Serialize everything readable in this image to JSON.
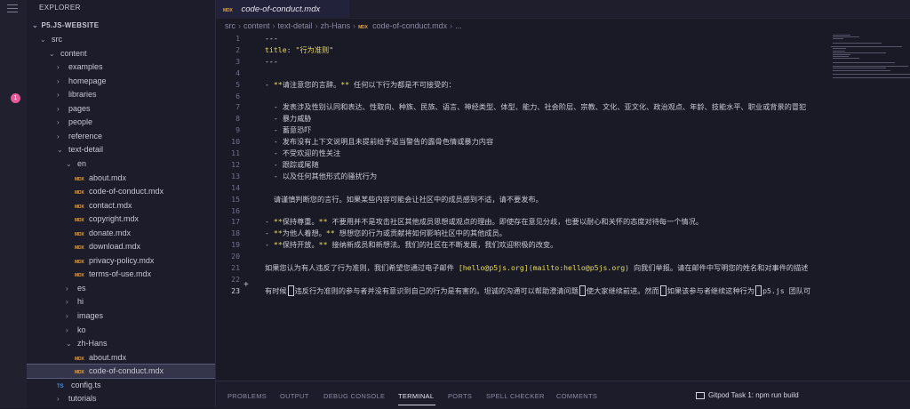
{
  "activity": {
    "badge": "1"
  },
  "sidebar": {
    "title": "EXPLORER",
    "root": "P5.JS-WEBSITE",
    "tree": [
      {
        "label": "src",
        "type": "folder",
        "open": true,
        "depth": 0
      },
      {
        "label": "content",
        "type": "folder",
        "open": true,
        "depth": 1
      },
      {
        "label": "examples",
        "type": "folder",
        "open": false,
        "depth": 2
      },
      {
        "label": "homepage",
        "type": "folder",
        "open": false,
        "depth": 2
      },
      {
        "label": "libraries",
        "type": "folder",
        "open": false,
        "depth": 2
      },
      {
        "label": "pages",
        "type": "folder",
        "open": false,
        "depth": 2
      },
      {
        "label": "people",
        "type": "folder",
        "open": false,
        "depth": 2
      },
      {
        "label": "reference",
        "type": "folder",
        "open": false,
        "depth": 2
      },
      {
        "label": "text-detail",
        "type": "folder",
        "open": true,
        "depth": 2
      },
      {
        "label": "en",
        "type": "folder",
        "open": true,
        "depth": 3
      },
      {
        "label": "about.mdx",
        "type": "mdx",
        "depth": 4
      },
      {
        "label": "code-of-conduct.mdx",
        "type": "mdx",
        "depth": 4
      },
      {
        "label": "contact.mdx",
        "type": "mdx",
        "depth": 4
      },
      {
        "label": "copyright.mdx",
        "type": "mdx",
        "depth": 4
      },
      {
        "label": "donate.mdx",
        "type": "mdx",
        "depth": 4
      },
      {
        "label": "download.mdx",
        "type": "mdx",
        "depth": 4
      },
      {
        "label": "privacy-policy.mdx",
        "type": "mdx",
        "depth": 4
      },
      {
        "label": "terms-of-use.mdx",
        "type": "mdx",
        "depth": 4
      },
      {
        "label": "es",
        "type": "folder",
        "open": false,
        "depth": 3
      },
      {
        "label": "hi",
        "type": "folder",
        "open": false,
        "depth": 3
      },
      {
        "label": "images",
        "type": "folder",
        "open": false,
        "depth": 3
      },
      {
        "label": "ko",
        "type": "folder",
        "open": false,
        "depth": 3
      },
      {
        "label": "zh-Hans",
        "type": "folder",
        "open": true,
        "depth": 3
      },
      {
        "label": "about.mdx",
        "type": "mdx",
        "depth": 4
      },
      {
        "label": "code-of-conduct.mdx",
        "type": "mdx",
        "depth": 4,
        "selected": true
      },
      {
        "label": "config.ts",
        "type": "ts",
        "depth": 2
      },
      {
        "label": "tutorials",
        "type": "folder",
        "open": false,
        "depth": 2
      }
    ]
  },
  "editor": {
    "tab_label": "code-of-conduct.mdx",
    "icon_mdx": "MDX",
    "icon_ts": "TS",
    "breadcrumb": [
      "src",
      "content",
      "text-detail",
      "zh-Hans",
      "code-of-conduct.mdx",
      "..."
    ],
    "lines": [
      {
        "n": "1",
        "html": "<span class='w'>---</span>"
      },
      {
        "n": "2",
        "html": "<span class='y'>title</span>: <span class='y'>\"行为准则\"</span>"
      },
      {
        "n": "3",
        "html": "<span class='w'>---</span>"
      },
      {
        "n": "4",
        "html": ""
      },
      {
        "n": "5",
        "html": "- <span class='k'>**</span>请注意您的言辞。<span class='k'>**</span> 任何以下行为都是不可接受的："
      },
      {
        "n": "6",
        "html": ""
      },
      {
        "n": "7",
        "html": "&nbsp;&nbsp;- 发表涉及性别认同和表达、性取向、种族、民族、语言、神经类型、体型、能力、社会阶层、宗教、文化、亚文化、政治观点、年龄、技能水平、职业或背景的冒犯"
      },
      {
        "n": "8",
        "html": "&nbsp;&nbsp;- 暴力威胁"
      },
      {
        "n": "9",
        "html": "&nbsp;&nbsp;- 蓄意恐吓"
      },
      {
        "n": "10",
        "html": "&nbsp;&nbsp;- 发布没有上下文说明且未提前给予适当警告的露骨色情或暴力内容"
      },
      {
        "n": "11",
        "html": "&nbsp;&nbsp;- 不受欢迎的性关注"
      },
      {
        "n": "12",
        "html": "&nbsp;&nbsp;- 跟踪或尾随"
      },
      {
        "n": "13",
        "html": "&nbsp;&nbsp;- 以及任何其他形式的骚扰行为"
      },
      {
        "n": "14",
        "html": ""
      },
      {
        "n": "15",
        "html": "&nbsp;&nbsp;请谨慎判断您的言行。如果某些内容可能会让社区中的成员感到不适，请不要发布。"
      },
      {
        "n": "16",
        "html": ""
      },
      {
        "n": "17",
        "html": "- <span class='k'>**</span>保持尊重。<span class='k'>**</span> 不要用并不是攻击社区其他成员思想或观点的理由。即使存在意见分歧，也要以耐心和关怀的态度对待每一个情况。"
      },
      {
        "n": "18",
        "html": "- <span class='k'>**</span>为他人着想。<span class='k'>**</span> 想想您的行为或贡献将如何影响社区中的其他成员。"
      },
      {
        "n": "19",
        "html": "- <span class='k'>**</span>保持开放。<span class='k'>**</span> 接纳新成员和新想法。我们的社区在不断发展，我们欢迎积极的改变。"
      },
      {
        "n": "20",
        "html": ""
      },
      {
        "n": "21",
        "html": "如果您认为有人违反了行为准则，我们希望您通过电子邮件 <span class='m'>[hello@p5js.org]</span>(<span class='m'>mailto:hello@p5js.org</span>) 向我们举报。请在邮件中写明您的姓名和对事件的描述"
      },
      {
        "n": "22",
        "html": ""
      },
      {
        "n": "23",
        "html": "有时候<span class='mark'></span>违反行为准则的参与者并没有意识到自己的行为是有害的。坦诚的沟通可以帮助澄清问题<span class='mark'></span>使大家继续前进。然而<span class='mark'></span>如果该参与者继续这种行为<span class='mark'></span>p5.js 团队可"
      }
    ],
    "current_line": "23"
  },
  "panel": {
    "tabs": [
      "PROBLEMS",
      "OUTPUT",
      "DEBUG CONSOLE",
      "TERMINAL",
      "PORTS",
      "SPELL CHECKER",
      "COMMENTS"
    ],
    "active_tab": "TERMINAL",
    "task": "Gitpod Task 1: npm run build"
  }
}
